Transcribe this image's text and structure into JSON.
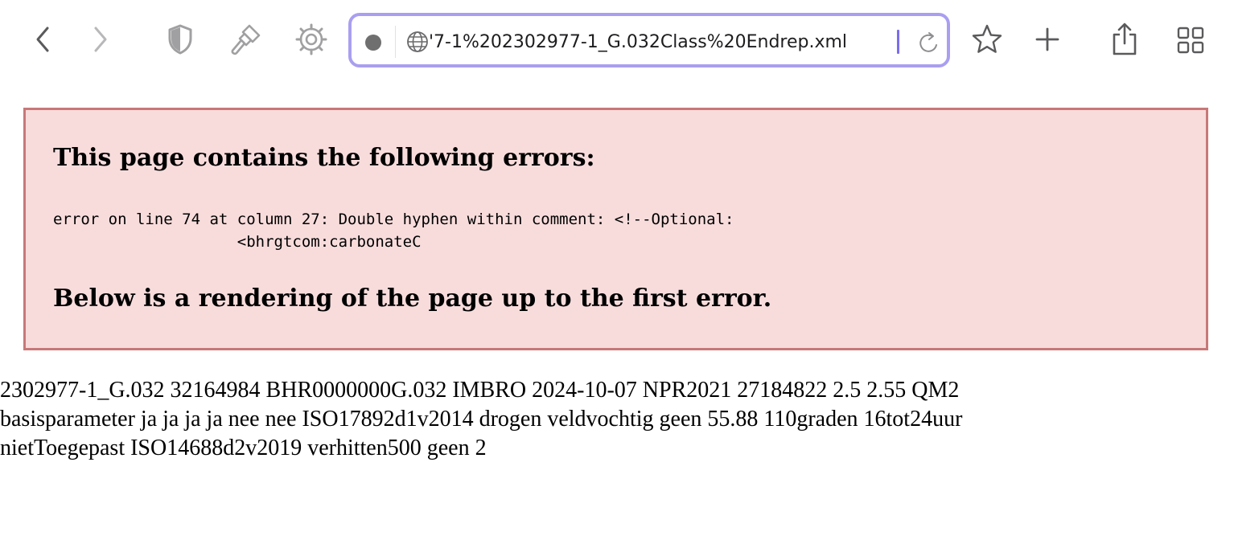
{
  "toolbar": {
    "back_icon": "chevron-left-icon",
    "forward_icon": "chevron-right-icon",
    "privacy_icon": "shield-icon",
    "extension_icon": "paintbrush-icon",
    "settings_icon": "gear-icon",
    "bookmark_icon": "star-icon",
    "new_tab_icon": "plus-icon",
    "share_icon": "share-icon",
    "tab_overview_icon": "grid-icon"
  },
  "address_bar": {
    "value": "'7-1%202302977-1_G.032Class%20Endrep.xml",
    "site_icon": "globe-icon",
    "reload_icon": "reload-icon",
    "accent_color": "#a99ff0"
  },
  "error": {
    "heading": "This page contains the following errors:",
    "detail_line1": "error on line 74 at column 27: Double hyphen within comment: <!--Optional:",
    "detail_line2": "                    <bhrgtcom:carbonateC",
    "footer": "Below is a rendering of the page up to the first error.",
    "background_color": "#f8dcdc",
    "border_color": "#c87878"
  },
  "rendered_content": {
    "line1": "2302977-1_G.032 32164984 BHR0000000G.032 IMBRO 2024-10-07 NPR2021 27184822 2.5 2.55 QM2",
    "line2": "basisparameter ja ja ja ja nee nee ISO17892d1v2014 drogen veldvochtig geen 55.88 110graden 16tot24uur",
    "line3": "nietToegepast ISO14688d2v2019 verhitten500 geen 2"
  }
}
